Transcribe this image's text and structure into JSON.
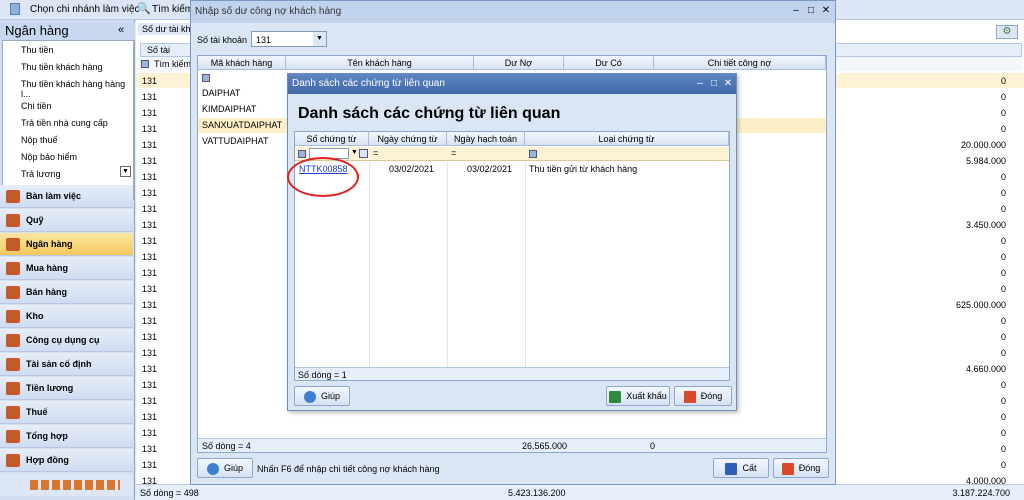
{
  "topbar": {
    "branch": "Chọn chi nhánh làm việc",
    "search": "Tìm kiếm"
  },
  "sidebar": {
    "title": "Ngân hàng",
    "list_items": [
      "Thu tiền",
      "Thu tiền khách hàng",
      "Thu tiền khách hàng hàng l...",
      "Chi tiền",
      "Trả tiền nhà cung cấp",
      "Nộp thuế",
      "Nộp bảo hiểm",
      "Trả lương"
    ],
    "modules": [
      "Bàn làm việc",
      "Quỹ",
      "Ngân hàng",
      "Mua hàng",
      "Bán hàng",
      "Kho",
      "Công cụ dụng cụ",
      "Tài sản cố định",
      "Tiền lương",
      "Thuế",
      "Tổng hợp",
      "Hợp đồng"
    ],
    "active_module": "Ngân hàng"
  },
  "main": {
    "tab": "Số dư tài kho",
    "col_header": "Số tài khoản",
    "filter_label": "Tìm kiếm",
    "account_code": "131",
    "amounts": [
      "0",
      "0",
      "0",
      "0",
      "20.000.000",
      "5.984.000",
      "0",
      "0",
      "0",
      "3.450.000",
      "0",
      "0",
      "0",
      "0",
      "625.000.000",
      "0",
      "0",
      "0",
      "4.660.000",
      "0",
      "0",
      "0",
      "0",
      "0",
      "0",
      "4.000.000"
    ],
    "footer_count": "Số dòng = 498",
    "footer_total": "5.423.136.200",
    "footer_total_right": "3.187.224.700"
  },
  "dialog1": {
    "title": "Nhập số dư công nợ khách hàng",
    "account_label": "Số tài khoản",
    "account_value": "131",
    "headers": [
      "Mã khách hàng",
      "Tên khách hàng",
      "Dư Nợ",
      "Dư Có",
      "Chi tiết công nợ"
    ],
    "rows": [
      "DAIPHAT",
      "KIMDAIPHAT",
      "SANXUATDAIPHAT",
      "VATTUDAIPHAT"
    ],
    "footer_count": "Số dòng = 4",
    "footer_debit": "26.565.000",
    "footer_credit": "0",
    "help_btn": "Giúp",
    "hint": "Nhấn F6 để nhập chi tiết công nợ khách hàng",
    "cut_btn": "Cất",
    "close_btn": "Đóng"
  },
  "dialog2": {
    "title": "Danh sách các chứng từ liên quan",
    "heading": "Danh sách các chứng từ liên quan",
    "headers": [
      "Số chứng từ",
      "Ngày chứng từ",
      "Ngày hạch toán",
      "Loại chứng từ"
    ],
    "rows": [
      {
        "doc_no": "NTTK00858",
        "doc_date": "03/02/2021",
        "post_date": "03/02/2021",
        "type": "Thu tiền gửi từ khách hàng"
      }
    ],
    "footer_count": "Số dòng = 1",
    "help_btn": "Giúp",
    "export_btn": "Xuất khẩu",
    "close_btn": "Đóng"
  }
}
